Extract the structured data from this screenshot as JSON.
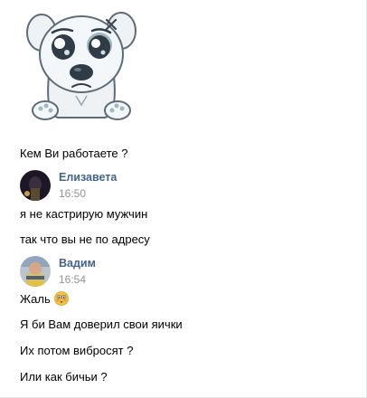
{
  "messages": {
    "m1": {
      "text": "Кем Ви работаете ?"
    },
    "group1": {
      "author": "Елизавета",
      "time": "16:50",
      "lines": [
        "я не кастрирую мужчин",
        "так что вы не по адресу"
      ]
    },
    "group2": {
      "author": "Вадим",
      "time": "16:54",
      "lines": [
        "Жаль",
        "Я би Вам доверил свои яички",
        "Их потом вибросят ?",
        "Или как бичьи ?"
      ]
    }
  },
  "sticker": {
    "icon": "sad-puppy-sticker"
  },
  "emoji": {
    "icon": "flushed-face-emoji"
  },
  "colors": {
    "author": "#42648b",
    "time": "#939393",
    "border": "#e7e8ec"
  }
}
